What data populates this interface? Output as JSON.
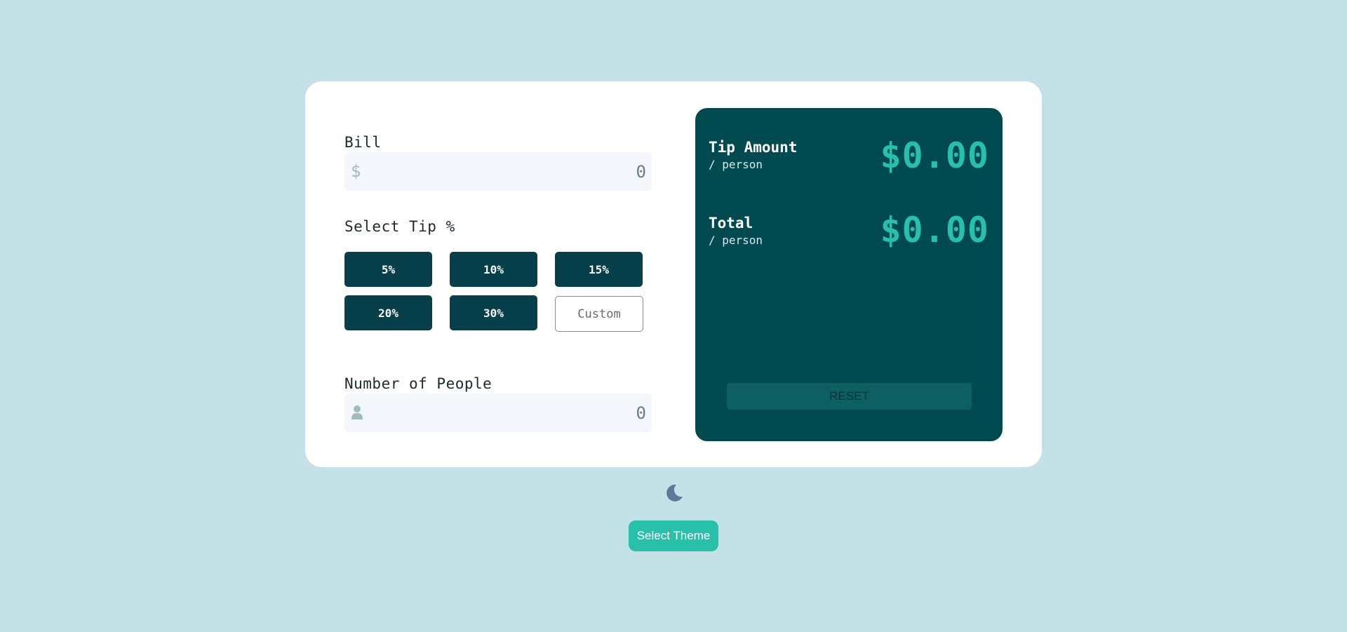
{
  "colors": {
    "page_background": "#c5e1e8",
    "card_background": "#ffffff",
    "panel_background": "#014a50",
    "tip_button": "#073f4b",
    "accent": "#26c0ab",
    "input_background": "#f3f6fa"
  },
  "bill": {
    "label": "Bill",
    "prefix": "$",
    "placeholder": "0"
  },
  "tip": {
    "label": "Select Tip %",
    "options": [
      "5%",
      "10%",
      "15%",
      "20%",
      "30%"
    ],
    "custom_placeholder": "Custom"
  },
  "people": {
    "label": "Number of People",
    "icon": "person-icon",
    "placeholder": "0"
  },
  "results": {
    "tip_amount": {
      "label": "Tip Amount",
      "sub": "/ person",
      "value": "$0.00"
    },
    "total": {
      "label": "Total",
      "sub": "/ person",
      "value": "$0.00"
    },
    "reset_label": "RESET"
  },
  "theme": {
    "icon": "moon-icon",
    "button_label": "Select Theme"
  }
}
